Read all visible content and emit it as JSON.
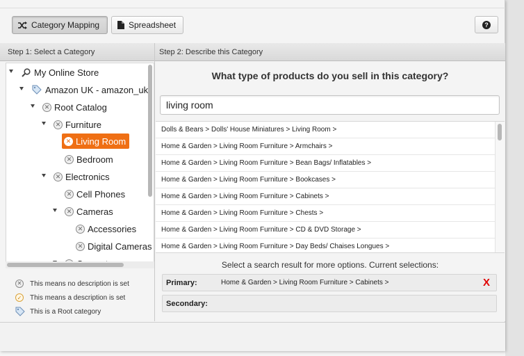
{
  "toolbar": {
    "category_mapping_label": "Category Mapping",
    "spreadsheet_label": "Spreadsheet",
    "help_symbol": "?"
  },
  "steps": {
    "step1_title": "Step 1: Select a Category",
    "step2_title": "Step 2: Describe this Category"
  },
  "tree": {
    "store": "My Online Store",
    "channel": "Amazon UK - amazon_uk",
    "root_catalog": "Root Catalog",
    "furniture": "Furniture",
    "living_room": "Living Room",
    "bedroom": "Bedroom",
    "electronics": "Electronics",
    "cell_phones": "Cell Phones",
    "cameras": "Cameras",
    "accessories": "Accessories",
    "digital_cameras": "Digital Cameras",
    "computers": "Computers"
  },
  "legend": {
    "no_description": "This means no description is set",
    "description_set": "This means a description is set",
    "root_category": "This is a Root category"
  },
  "describe": {
    "question": "What type of products do you sell in this category?",
    "search_value": "living room",
    "results": [
      "Dolls & Bears > Dolls' House Miniatures > Living Room >",
      "Home & Garden > Living Room Furniture > Armchairs >",
      "Home & Garden > Living Room Furniture > Bean Bags/ Inflatables >",
      "Home & Garden > Living Room Furniture > Bookcases >",
      "Home & Garden > Living Room Furniture > Cabinets >",
      "Home & Garden > Living Room Furniture > Chests >",
      "Home & Garden > Living Room Furniture > CD & DVD Storage >",
      "Home & Garden > Living Room Furniture > Day Beds/ Chaises Longues >"
    ],
    "selection_note": "Select a search result for more options. Current selections:",
    "primary_label": "Primary:",
    "primary_value": "Home & Garden > Living Room Furniture > Cabinets >",
    "remove_symbol": "X",
    "secondary_label": "Secondary:",
    "secondary_value": ""
  },
  "colors": {
    "selected": "#ef6f14",
    "remove": "#e00000"
  }
}
